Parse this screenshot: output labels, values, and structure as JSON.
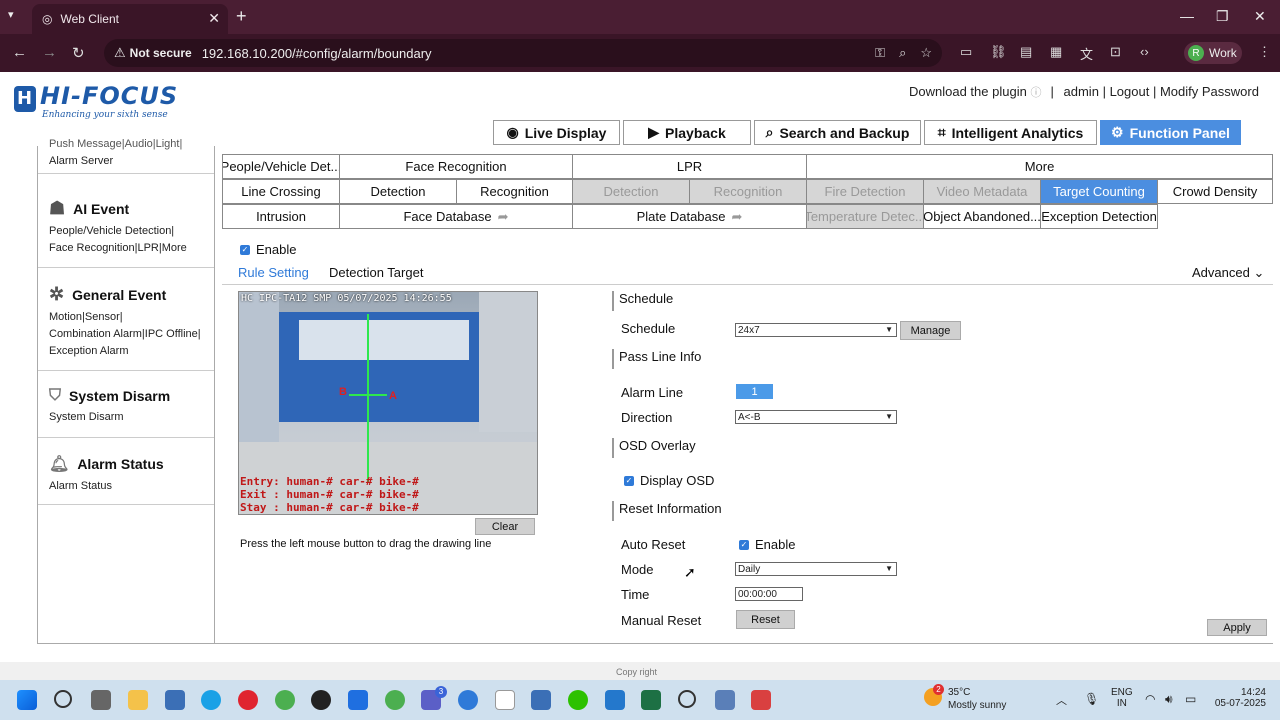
{
  "browser": {
    "tab_title": "Web Client",
    "url": "192.168.10.200/#config/alarm/boundary",
    "security_label": "Not secure",
    "profile_label": "Work",
    "profile_initial": "R"
  },
  "header": {
    "logo_text": "HI-FOCUS",
    "logo_tagline": "Enhancing your sixth sense",
    "download_plugin": "Download the plugin",
    "admin": "admin",
    "logout": "Logout",
    "modify_password": "Modify Password",
    "nav": {
      "live_display": "Live Display",
      "playback": "Playback",
      "search_backup": "Search and Backup",
      "intelligent_analytics": "Intelligent Analytics",
      "function_panel": "Function Panel"
    }
  },
  "sidebar": {
    "partial_top": "Push Message|Audio|Light|",
    "partial_top2": "Alarm Server",
    "ai_event": {
      "title": "AI Event",
      "line1": "People/Vehicle Detection|",
      "line2": "Face Recognition|LPR|More"
    },
    "general_event": {
      "title": "General Event",
      "line1": "Motion|Sensor|",
      "line2": "Combination Alarm|IPC Offline|",
      "line3": "Exception Alarm"
    },
    "system_disarm": {
      "title": "System Disarm",
      "line1": "System Disarm"
    },
    "alarm_status": {
      "title": "Alarm Status",
      "line1": "Alarm Status"
    }
  },
  "tabs": {
    "row1": [
      "People/Vehicle Det...",
      "Face Recognition",
      "LPR",
      "More"
    ],
    "row2": [
      "Line Crossing",
      "Detection",
      "Recognition",
      "Detection",
      "Recognition",
      "Fire Detection",
      "Video Metadata",
      "Target Counting",
      "Crowd Density"
    ],
    "row3": [
      "Intrusion",
      "Face Database",
      "Plate Database",
      "Temperature Detec...",
      "Object Abandoned...",
      "Exception Detection"
    ]
  },
  "form": {
    "enable": "Enable",
    "rule_setting": "Rule Setting",
    "detection_target": "Detection Target",
    "advanced": "Advanced",
    "camera_osd_top": "HC IPC-TA12 SMP  05/07/2025 14:26:55",
    "osd_entry": "Entry: human-# car-# bike-#",
    "osd_exit": "Exit   : human-# car-# bike-#",
    "osd_stay": "Stay   : human-# car-# bike-#",
    "line_label_a": "A",
    "line_label_b": "B",
    "clear": "Clear",
    "hint": "Press the left mouse button to drag the drawing line",
    "schedule_section": "Schedule",
    "schedule_label": "Schedule",
    "schedule_value": "24x7",
    "manage": "Manage",
    "pass_line_section": "Pass Line Info",
    "alarm_line_label": "Alarm Line",
    "alarm_line_value": "1",
    "direction_label": "Direction",
    "direction_value": "A<-B",
    "osd_section": "OSD Overlay",
    "display_osd": "Display OSD",
    "reset_section": "Reset Information",
    "auto_reset_label": "Auto Reset",
    "auto_reset_enable": "Enable",
    "mode_label": "Mode",
    "mode_value": "Daily",
    "time_label": "Time",
    "time_value": "00:00:00",
    "manual_reset_label": "Manual Reset",
    "reset": "Reset",
    "apply": "Apply",
    "copyright": "Copy right"
  },
  "taskbar": {
    "weather_temp": "35°C",
    "weather_desc": "Mostly sunny",
    "weather_badge": "2",
    "lang1": "ENG",
    "lang2": "IN",
    "time": "14:24",
    "date": "05-07-2025",
    "teams_badge": "3"
  }
}
